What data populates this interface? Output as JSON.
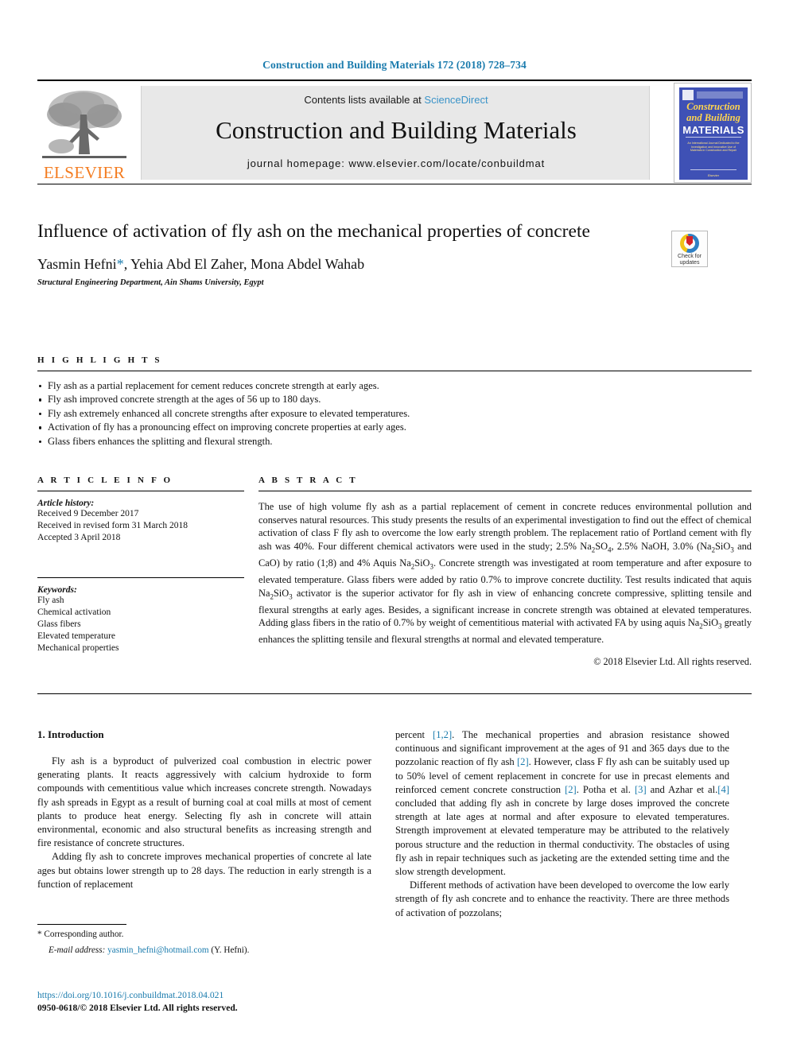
{
  "running_head": "Construction and Building Materials 172 (2018) 728–734",
  "masthead": {
    "publisher_logo_text": "ELSEVIER",
    "contents_prefix": "Contents lists available at ",
    "contents_link": "ScienceDirect",
    "journal_title": "Construction and Building Materials",
    "journal_homepage": "journal homepage: www.elsevier.com/locate/conbuildmat",
    "cover": {
      "line1": "Construction",
      "line2": "and Building",
      "line3": "MATERIALS",
      "subtitle": "An International Journal Dedicated to the Investigation and Innovative Use of Materials in Construction and Repair",
      "publisher": "Elsevier"
    }
  },
  "article": {
    "title": "Influence of activation of fly ash on the mechanical properties of concrete",
    "authors": "Yasmin Hefni , Yehia Abd El Zaher, Mona Abdel Wahab",
    "author_names": "Yasmin Hefni",
    "author_rest": ", Yehia Abd El Zaher, Mona Abdel Wahab",
    "corresponding_marker": "*",
    "affiliation": "Structural Engineering Department, Ain Shams University, Egypt"
  },
  "crossmark": {
    "label_line1": "Check for",
    "label_line2": "updates"
  },
  "highlights": {
    "label": "H I G H L I G H T S",
    "items": [
      "Fly ash as a partial replacement for cement reduces concrete strength at early ages.",
      "Fly ash improved concrete strength at the ages of 56 up to 180 days.",
      "Fly ash extremely enhanced all concrete strengths after exposure to elevated temperatures.",
      "Activation of fly has a pronouncing effect on improving concrete properties at early ages.",
      "Glass fibers enhances the splitting and flexural strength."
    ]
  },
  "article_info": {
    "label": "A R T I C L E   I N F O",
    "history_label": "Article history:",
    "history": [
      "Received 9 December 2017",
      "Received in revised form 31 March 2018",
      "Accepted 3 April 2018"
    ],
    "keywords_label": "Keywords:",
    "keywords": [
      "Fly ash",
      "Chemical activation",
      "Glass fibers",
      "Elevated temperature",
      "Mechanical properties"
    ]
  },
  "abstract": {
    "label": "A B S T R A C T",
    "paragraph_html": "The use of high volume fly ash as a partial replacement of cement in concrete reduces environmental pollution and conserves natural resources. This study presents the results of an experimental investigation to find out the effect of chemical activation of class F fly ash to overcome the low early strength problem. The replacement ratio of Portland cement with fly ash was 40%. Four different chemical activators were used in the study; 2.5% Na<sub>2</sub>SO<sub>4</sub>, 2.5% NaOH, 3.0% (Na<sub>2</sub>SiO<sub>3</sub> and CaO) by ratio (1;8) and 4% Aquis Na<sub>2</sub>SiO<sub>3</sub>. Concrete strength was investigated at room temperature and after exposure to elevated temperature. Glass fibers were added by ratio 0.7% to improve concrete ductility. Test results indicated that aquis Na<sub>2</sub>SiO<sub>3</sub> activator is the superior activator for fly ash in view of enhancing concrete compressive, splitting tensile and flexural strengths at early ages. Besides, a significant increase in concrete strength was obtained at elevated temperatures. Adding glass fibers in the ratio of 0.7% by weight of cementitious material with activated FA by using aquis Na<sub>2</sub>SiO<sub>3</sub> greatly enhances the splitting tensile and flexural strengths at normal and elevated temperature.",
    "copyright": "© 2018 Elsevier Ltd. All rights reserved."
  },
  "body": {
    "section_heading": "1. Introduction",
    "left_paragraph_1": "Fly ash is a byproduct of pulverized coal combustion in electric power generating plants. It reacts aggressively with calcium hydroxide to form compounds with cementitious value which increases concrete strength. Nowadays fly ash spreads in Egypt as a result of burning coal at coal mills at most of cement plants to produce heat energy. Selecting fly ash in concrete will attain environmental, economic and also structural benefits as increasing strength and fire resistance of concrete structures.",
    "left_paragraph_2": "Adding fly ash to concrete improves mechanical properties of concrete al late ages but obtains lower strength up to 28 days. The reduction in early strength is a function of replacement",
    "right_paragraph_1_html": "percent <span class=\"link\">[1,2]</span>. The mechanical properties and abrasion resistance showed continuous and significant improvement at the ages of 91 and 365 days due to the pozzolanic reaction of fly ash <span class=\"link\">[2]</span>. However, class F fly ash can be suitably used up to 50% level of cement replacement in concrete for use in precast elements and reinforced cement concrete construction <span class=\"link\">[2]</span>. Potha et al. <span class=\"link\">[3]</span> and Azhar et al.<span class=\"link\">[4]</span> concluded that adding fly ash in concrete by large doses improved the concrete strength at late ages at normal and after exposure to elevated temperatures. Strength improvement at elevated temperature may be attributed to the relatively porous structure and the reduction in thermal conductivity. The obstacles of using fly ash in repair techniques such as jacketing are the extended setting time and the slow strength development.",
    "right_paragraph_2": "Different methods of activation have been developed to overcome the low early strength of fly ash concrete and to enhance the reactivity. There are three methods of activation of pozzolans;"
  },
  "footer": {
    "corresponding": "* Corresponding author.",
    "email_label": "E-mail address:",
    "email": "yasmin_hefni@hotmail.com",
    "email_suffix": "(Y. Hefni).",
    "doi": "https://doi.org/10.1016/j.conbuildmat.2018.04.021",
    "issn_line": "0950-0618/© 2018 Elsevier Ltd. All rights reserved."
  },
  "colors": {
    "link_blue": "#1a7bad",
    "sciencedirect_blue": "#3a93c8",
    "elsevier_orange": "#f47c20",
    "cover_blue": "#3f51b5"
  }
}
